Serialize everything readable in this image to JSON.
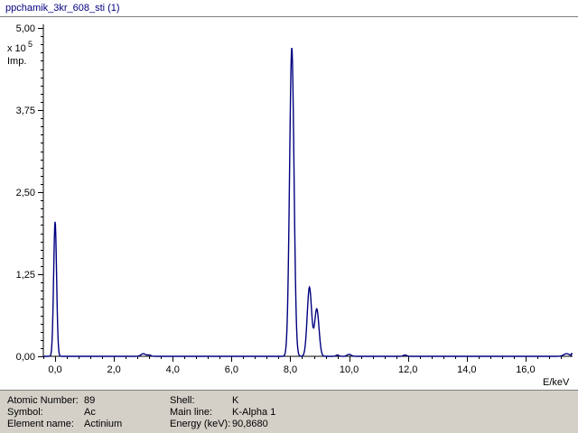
{
  "window": {
    "title": "ppchamik_3kr_608_sti (1)"
  },
  "chart_data": {
    "type": "line",
    "xlabel": "E/keV",
    "ylabel_scale_prefix": "x 10",
    "ylabel_scale_exp": "5",
    "ylabel_unit": "Imp.",
    "xlim": [
      -0.4,
      17.6
    ],
    "ylim": [
      0,
      5.0
    ],
    "x_ticks": [
      "0,0",
      "2,0",
      "4,0",
      "6,0",
      "8,0",
      "10,0",
      "12,0",
      "14,0",
      "16,0"
    ],
    "x_tick_values": [
      0,
      2,
      4,
      6,
      8,
      10,
      12,
      14,
      16
    ],
    "y_ticks": [
      "0,00",
      "1,25",
      "2,50",
      "3,75",
      "5,00"
    ],
    "y_tick_values": [
      0,
      1.25,
      2.5,
      3.75,
      5.0
    ],
    "line_color": "#000080",
    "series": [
      {
        "peaks": [
          {
            "x": 0.0,
            "y": 2.05,
            "w": 0.05
          },
          {
            "x": 3.0,
            "y": 0.04,
            "w": 0.08
          },
          {
            "x": 3.2,
            "y": 0.02,
            "w": 0.06
          },
          {
            "x": 8.05,
            "y": 4.7,
            "w": 0.075
          },
          {
            "x": 8.65,
            "y": 1.05,
            "w": 0.075
          },
          {
            "x": 8.9,
            "y": 0.72,
            "w": 0.075
          },
          {
            "x": 9.6,
            "y": 0.02,
            "w": 0.05
          },
          {
            "x": 10.0,
            "y": 0.03,
            "w": 0.07
          },
          {
            "x": 11.9,
            "y": 0.02,
            "w": 0.06
          },
          {
            "x": 17.4,
            "y": 0.04,
            "w": 0.1
          }
        ]
      }
    ]
  },
  "info": {
    "atomic_number_label": "Atomic Number:",
    "atomic_number_value": "89",
    "symbol_label": "Symbol:",
    "symbol_value": "Ac",
    "element_name_label": "Element name:",
    "element_name_value": "Actinium",
    "shell_label": "Shell:",
    "shell_value": "K",
    "main_line_label": "Main line:",
    "main_line_value": "K-Alpha 1",
    "energy_label": "Energy (keV):",
    "energy_value": "90,8680"
  }
}
